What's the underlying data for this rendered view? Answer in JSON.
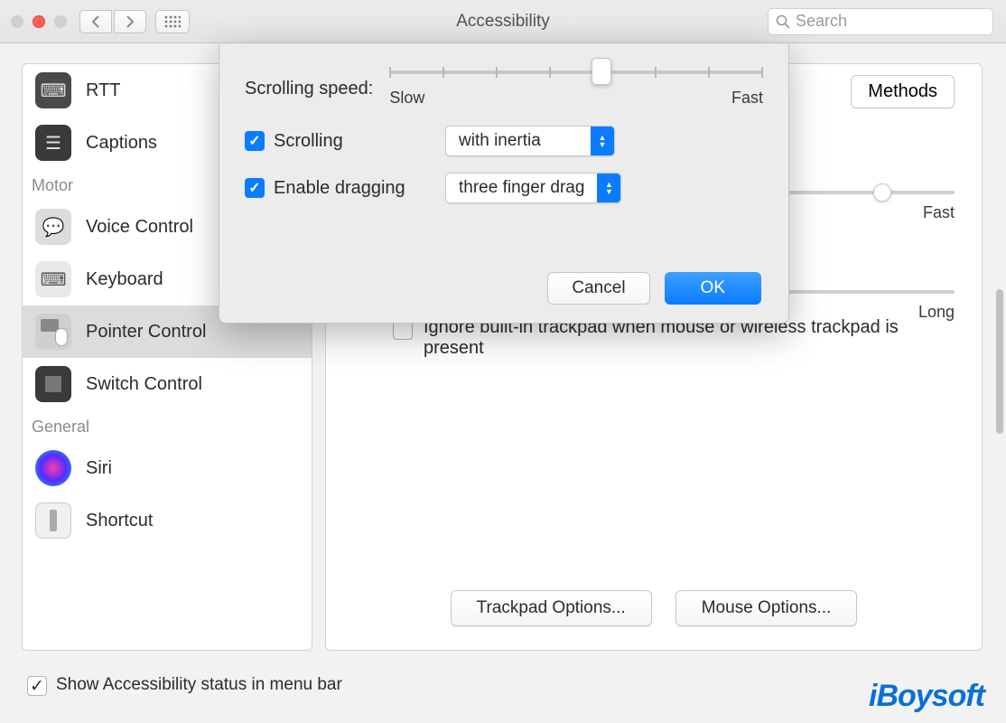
{
  "window": {
    "title": "Accessibility"
  },
  "search": {
    "placeholder": "Search"
  },
  "sidebar": {
    "sections": {
      "motor_label": "Motor",
      "general_label": "General"
    },
    "items": [
      {
        "label": "RTT",
        "icon": "rtt-icon"
      },
      {
        "label": "Captions",
        "icon": "captions-icon"
      },
      {
        "label": "Voice Control",
        "icon": "voice-control-icon"
      },
      {
        "label": "Keyboard",
        "icon": "keyboard-icon"
      },
      {
        "label": "Pointer Control",
        "icon": "pointer-control-icon",
        "selected": true
      },
      {
        "label": "Switch Control",
        "icon": "switch-control-icon"
      },
      {
        "label": "Siri",
        "icon": "siri-icon"
      },
      {
        "label": "Shortcut",
        "icon": "shortcut-icon"
      }
    ]
  },
  "content": {
    "tab_visible": "Methods",
    "speed_label_fast": "Fast",
    "duration_label_long": "Long",
    "ignore_trackpad_label": "Ignore built-in trackpad when mouse or wireless trackpad is present",
    "ignore_trackpad_checked": false,
    "trackpad_options_btn": "Trackpad Options...",
    "mouse_options_btn": "Mouse Options..."
  },
  "sheet": {
    "scroll_speed_label": "Scrolling speed:",
    "slow_label": "Slow",
    "fast_label": "Fast",
    "scrolling_checkbox": "Scrolling",
    "scrolling_popup": "with inertia",
    "dragging_checkbox": "Enable dragging",
    "dragging_popup": "three finger drag",
    "cancel": "Cancel",
    "ok": "OK"
  },
  "footer": {
    "show_status_label": "Show Accessibility status in menu bar",
    "checked": true
  },
  "watermark": "iBoysoft"
}
